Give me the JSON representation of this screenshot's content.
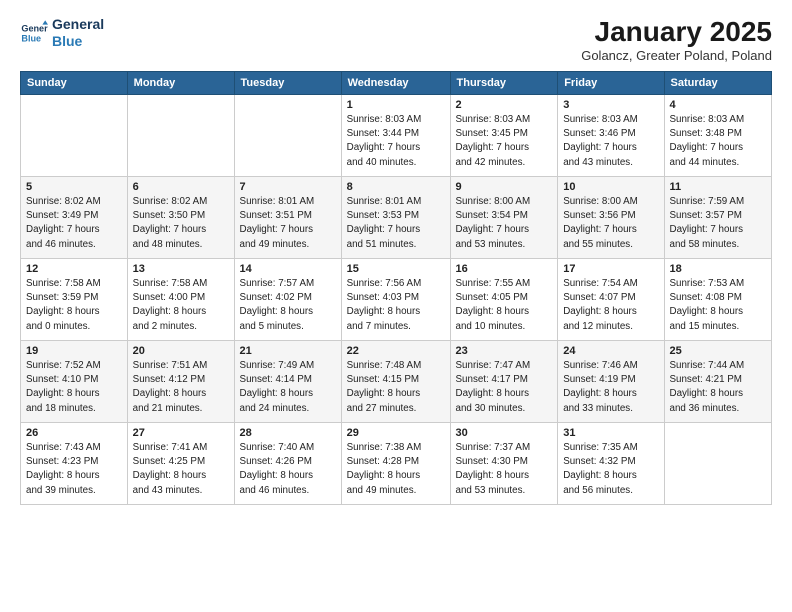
{
  "logo": {
    "line1": "General",
    "line2": "Blue"
  },
  "title": "January 2025",
  "subtitle": "Golancz, Greater Poland, Poland",
  "weekdays": [
    "Sunday",
    "Monday",
    "Tuesday",
    "Wednesday",
    "Thursday",
    "Friday",
    "Saturday"
  ],
  "weeks": [
    [
      {
        "day": "",
        "info": ""
      },
      {
        "day": "",
        "info": ""
      },
      {
        "day": "",
        "info": ""
      },
      {
        "day": "1",
        "info": "Sunrise: 8:03 AM\nSunset: 3:44 PM\nDaylight: 7 hours\nand 40 minutes."
      },
      {
        "day": "2",
        "info": "Sunrise: 8:03 AM\nSunset: 3:45 PM\nDaylight: 7 hours\nand 42 minutes."
      },
      {
        "day": "3",
        "info": "Sunrise: 8:03 AM\nSunset: 3:46 PM\nDaylight: 7 hours\nand 43 minutes."
      },
      {
        "day": "4",
        "info": "Sunrise: 8:03 AM\nSunset: 3:48 PM\nDaylight: 7 hours\nand 44 minutes."
      }
    ],
    [
      {
        "day": "5",
        "info": "Sunrise: 8:02 AM\nSunset: 3:49 PM\nDaylight: 7 hours\nand 46 minutes."
      },
      {
        "day": "6",
        "info": "Sunrise: 8:02 AM\nSunset: 3:50 PM\nDaylight: 7 hours\nand 48 minutes."
      },
      {
        "day": "7",
        "info": "Sunrise: 8:01 AM\nSunset: 3:51 PM\nDaylight: 7 hours\nand 49 minutes."
      },
      {
        "day": "8",
        "info": "Sunrise: 8:01 AM\nSunset: 3:53 PM\nDaylight: 7 hours\nand 51 minutes."
      },
      {
        "day": "9",
        "info": "Sunrise: 8:00 AM\nSunset: 3:54 PM\nDaylight: 7 hours\nand 53 minutes."
      },
      {
        "day": "10",
        "info": "Sunrise: 8:00 AM\nSunset: 3:56 PM\nDaylight: 7 hours\nand 55 minutes."
      },
      {
        "day": "11",
        "info": "Sunrise: 7:59 AM\nSunset: 3:57 PM\nDaylight: 7 hours\nand 58 minutes."
      }
    ],
    [
      {
        "day": "12",
        "info": "Sunrise: 7:58 AM\nSunset: 3:59 PM\nDaylight: 8 hours\nand 0 minutes."
      },
      {
        "day": "13",
        "info": "Sunrise: 7:58 AM\nSunset: 4:00 PM\nDaylight: 8 hours\nand 2 minutes."
      },
      {
        "day": "14",
        "info": "Sunrise: 7:57 AM\nSunset: 4:02 PM\nDaylight: 8 hours\nand 5 minutes."
      },
      {
        "day": "15",
        "info": "Sunrise: 7:56 AM\nSunset: 4:03 PM\nDaylight: 8 hours\nand 7 minutes."
      },
      {
        "day": "16",
        "info": "Sunrise: 7:55 AM\nSunset: 4:05 PM\nDaylight: 8 hours\nand 10 minutes."
      },
      {
        "day": "17",
        "info": "Sunrise: 7:54 AM\nSunset: 4:07 PM\nDaylight: 8 hours\nand 12 minutes."
      },
      {
        "day": "18",
        "info": "Sunrise: 7:53 AM\nSunset: 4:08 PM\nDaylight: 8 hours\nand 15 minutes."
      }
    ],
    [
      {
        "day": "19",
        "info": "Sunrise: 7:52 AM\nSunset: 4:10 PM\nDaylight: 8 hours\nand 18 minutes."
      },
      {
        "day": "20",
        "info": "Sunrise: 7:51 AM\nSunset: 4:12 PM\nDaylight: 8 hours\nand 21 minutes."
      },
      {
        "day": "21",
        "info": "Sunrise: 7:49 AM\nSunset: 4:14 PM\nDaylight: 8 hours\nand 24 minutes."
      },
      {
        "day": "22",
        "info": "Sunrise: 7:48 AM\nSunset: 4:15 PM\nDaylight: 8 hours\nand 27 minutes."
      },
      {
        "day": "23",
        "info": "Sunrise: 7:47 AM\nSunset: 4:17 PM\nDaylight: 8 hours\nand 30 minutes."
      },
      {
        "day": "24",
        "info": "Sunrise: 7:46 AM\nSunset: 4:19 PM\nDaylight: 8 hours\nand 33 minutes."
      },
      {
        "day": "25",
        "info": "Sunrise: 7:44 AM\nSunset: 4:21 PM\nDaylight: 8 hours\nand 36 minutes."
      }
    ],
    [
      {
        "day": "26",
        "info": "Sunrise: 7:43 AM\nSunset: 4:23 PM\nDaylight: 8 hours\nand 39 minutes."
      },
      {
        "day": "27",
        "info": "Sunrise: 7:41 AM\nSunset: 4:25 PM\nDaylight: 8 hours\nand 43 minutes."
      },
      {
        "day": "28",
        "info": "Sunrise: 7:40 AM\nSunset: 4:26 PM\nDaylight: 8 hours\nand 46 minutes."
      },
      {
        "day": "29",
        "info": "Sunrise: 7:38 AM\nSunset: 4:28 PM\nDaylight: 8 hours\nand 49 minutes."
      },
      {
        "day": "30",
        "info": "Sunrise: 7:37 AM\nSunset: 4:30 PM\nDaylight: 8 hours\nand 53 minutes."
      },
      {
        "day": "31",
        "info": "Sunrise: 7:35 AM\nSunset: 4:32 PM\nDaylight: 8 hours\nand 56 minutes."
      },
      {
        "day": "",
        "info": ""
      }
    ]
  ]
}
